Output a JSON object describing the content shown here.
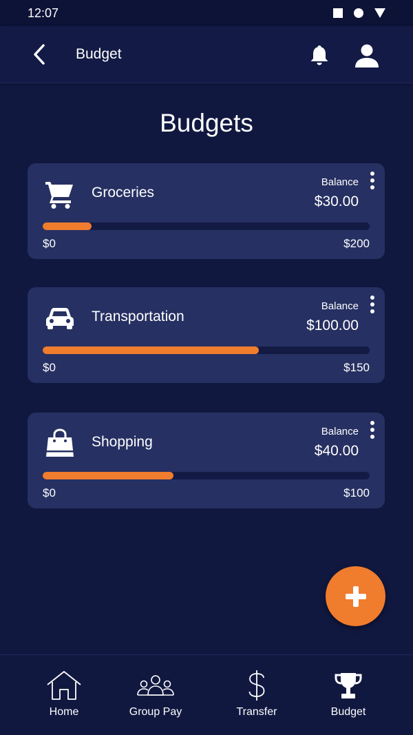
{
  "status_bar": {
    "time": "12:07"
  },
  "app_bar": {
    "title": "Budget"
  },
  "page": {
    "title": "Budgets"
  },
  "budgets": [
    {
      "name": "Groceries",
      "icon": "shopping-cart-icon",
      "balance_label": "Balance",
      "balance": "$30.00",
      "min": "$0",
      "max": "$200",
      "progress": 0.15
    },
    {
      "name": "Transportation",
      "icon": "car-icon",
      "balance_label": "Balance",
      "balance": "$100.00",
      "min": "$0",
      "max": "$150",
      "progress": 0.66
    },
    {
      "name": "Shopping",
      "icon": "shopping-bag-icon",
      "balance_label": "Balance",
      "balance": "$40.00",
      "min": "$0",
      "max": "$100",
      "progress": 0.4
    }
  ],
  "fab": {
    "icon": "plus-icon"
  },
  "bottom_nav": [
    {
      "label": "Home",
      "icon": "home-icon"
    },
    {
      "label": "Group Pay",
      "icon": "group-icon"
    },
    {
      "label": "Transfer",
      "icon": "dollar-icon"
    },
    {
      "label": "Budget",
      "icon": "trophy-icon"
    }
  ],
  "colors": {
    "background": "#111840",
    "card": "#263062",
    "accent": "#f07c2e",
    "track": "#131a44"
  }
}
